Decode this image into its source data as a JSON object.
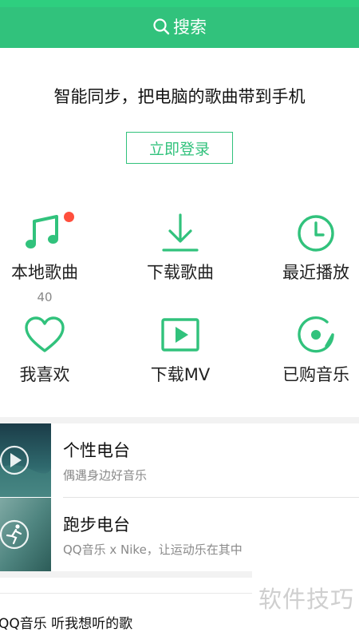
{
  "header": {
    "search_label": "搜索"
  },
  "sync": {
    "text": "智能同步，把电脑的歌曲带到手机",
    "login_label": "立即登录"
  },
  "features": [
    {
      "label": "本地歌曲",
      "count": "40",
      "icon": "music-note-icon"
    },
    {
      "label": "下载歌曲",
      "icon": "download-icon"
    },
    {
      "label": "最近播放",
      "icon": "clock-icon"
    },
    {
      "label": "我喜欢",
      "icon": "heart-icon"
    },
    {
      "label": "下载MV",
      "icon": "mv-play-icon"
    },
    {
      "label": "已购音乐",
      "icon": "purchased-music-icon"
    }
  ],
  "radios": [
    {
      "title": "个性电台",
      "subtitle": "偶遇身边好音乐"
    },
    {
      "title": "跑步电台",
      "subtitle": "QQ音乐 x Nike，让运动乐在其中"
    }
  ],
  "watermark": "软件技巧",
  "bottom": {
    "text": "QQ音乐 听我想听的歌"
  },
  "colors": {
    "accent": "#31c27c",
    "badge": "#ff4f3d"
  }
}
